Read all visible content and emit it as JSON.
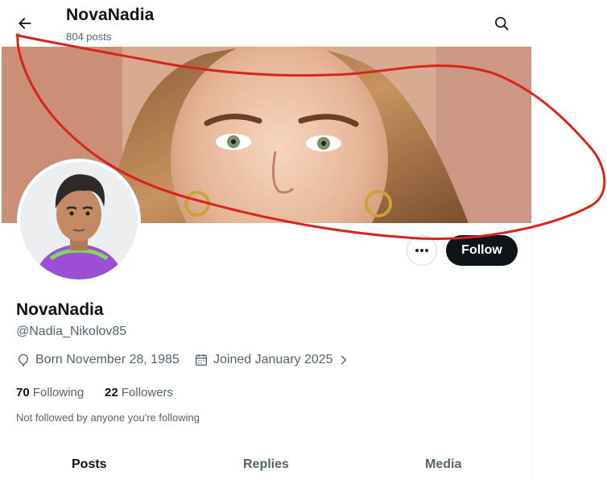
{
  "header": {
    "title": "NovaNadia",
    "posts_count": "804 posts"
  },
  "profile": {
    "display_name": "NovaNadia",
    "handle": "@Nadia_Nikolov85",
    "born": "Born November 28, 1985",
    "joined": "Joined January 2025",
    "following_count": "70",
    "following_label": "Following",
    "followers_count": "22",
    "followers_label": "Followers",
    "not_followed_note": "Not followed by anyone you're following"
  },
  "actions": {
    "follow_label": "Follow"
  },
  "tabs": [
    {
      "label": "Posts",
      "active": true
    },
    {
      "label": "Replies",
      "active": false
    },
    {
      "label": "Media",
      "active": false
    }
  ],
  "icons": {
    "back": "arrow-left-icon",
    "search": "search-icon",
    "more": "more-horizontal-icon",
    "born": "balloon-icon",
    "joined": "calendar-icon",
    "chevron": "chevron-right-icon"
  },
  "colors": {
    "text_primary": "#0f1419",
    "text_secondary": "#536471",
    "follow_button_bg": "#0f1419",
    "annotation": "#d9241c"
  }
}
